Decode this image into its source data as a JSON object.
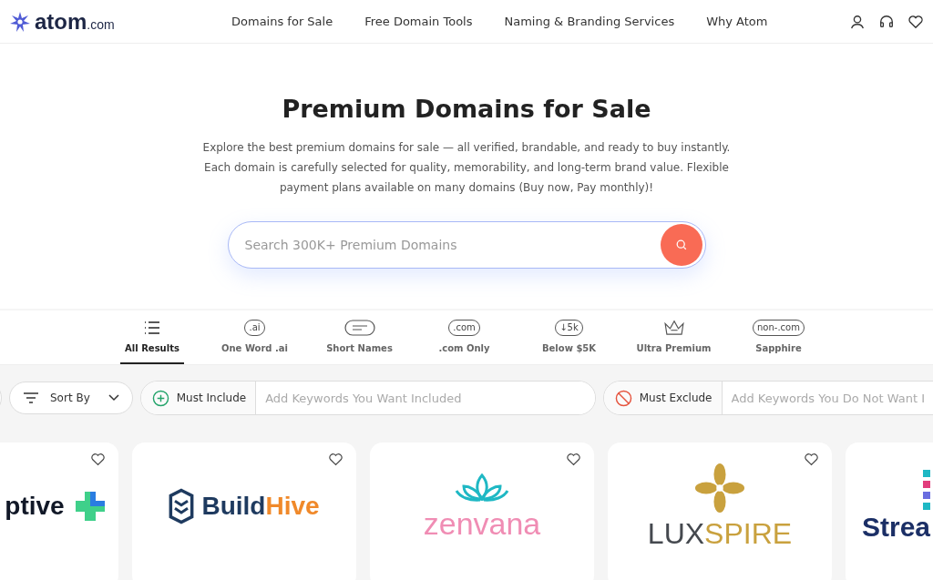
{
  "header": {
    "logo_text": "atom",
    "logo_suffix": ".com",
    "nav": [
      "Domains for Sale",
      "Free Domain Tools",
      "Naming & Branding Services",
      "Why Atom"
    ]
  },
  "hero": {
    "title": "Premium Domains for Sale",
    "description": "Explore the best premium domains for sale — all verified, brandable, and ready to buy instantly. Each domain is carefully selected for quality, memorability, and long-term brand value. Flexible payment plans available on many domains (Buy now, Pay monthly)!",
    "search": {
      "placeholder": "Search 300K+ Premium Domains"
    }
  },
  "tabs": [
    {
      "label": "All Results",
      "kind": "list",
      "selected": true
    },
    {
      "label": "One Word .ai",
      "kind": "pill",
      "icon_text": ".ai",
      "selected": false
    },
    {
      "label": "Short Names",
      "kind": "lines",
      "selected": false
    },
    {
      "label": ".com Only",
      "kind": "pill",
      "icon_text": ".com",
      "selected": false
    },
    {
      "label": "Below $5K",
      "kind": "down",
      "icon_text": "↓5k",
      "selected": false
    },
    {
      "label": "Ultra Premium",
      "kind": "crown",
      "selected": false
    },
    {
      "label": "Sapphire",
      "kind": "pill",
      "icon_text": "non-.com",
      "selected": false
    }
  ],
  "filters": {
    "sort_label": "Sort By",
    "include": {
      "label": "Must Include",
      "placeholder": "Add Keywords You Want Included"
    },
    "exclude": {
      "label": "Must Exclude",
      "placeholder": "Add Keywords You Do Not Want I"
    }
  },
  "cards": [
    {
      "kind": "cross",
      "parts": [
        {
          "text": "ptive",
          "color": "#111827"
        }
      ]
    },
    {
      "kind": "hex",
      "parts": [
        {
          "text": "Build",
          "color": "#1e3a5f"
        },
        {
          "text": "Hive",
          "color": "#f0892a"
        }
      ]
    },
    {
      "kind": "lotus",
      "parts": [
        {
          "text": "zenvana",
          "color": "#f08db4"
        }
      ]
    },
    {
      "kind": "flower",
      "parts": [
        {
          "text": "LUX",
          "color": "#45494f"
        },
        {
          "text": "SPIRE",
          "color": "#c9a13e"
        }
      ]
    },
    {
      "kind": "bars",
      "parts": [
        {
          "text": "Strea",
          "color": "#1b2f66"
        }
      ]
    }
  ]
}
